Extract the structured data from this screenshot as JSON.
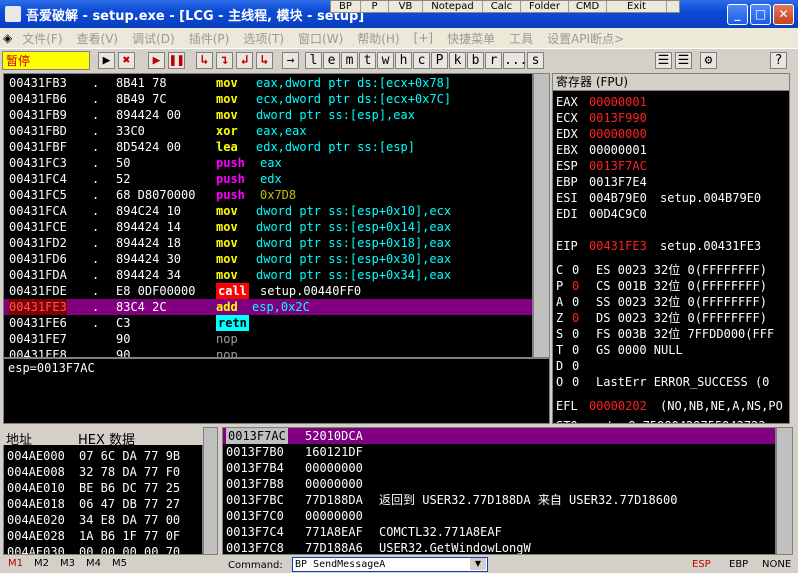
{
  "window": {
    "title": "吾爱破解 - setup.exe - [LCG - 主线程, 模块 - setup]",
    "minimize": "_",
    "maximize": "□",
    "close": "✕"
  },
  "plugin_bar": [
    "BP",
    "P",
    "VB",
    "Notepad",
    "Calc",
    "Folder",
    "CMD",
    "Exit"
  ],
  "menu": [
    "文件(F)",
    "查看(V)",
    "调试(D)",
    "插件(P)",
    "选项(T)",
    "窗口(W)",
    "帮助(H)",
    "[+]",
    "快捷菜单",
    "工具",
    "设置API断点>"
  ],
  "toolbar": {
    "status": "暂停",
    "buttons": [
      "▶",
      "✖",
      "▶",
      "❚❚",
      "↳",
      "↴",
      "↲",
      "↳",
      "→",
      "l",
      "e",
      "m",
      "t",
      "w",
      "h",
      "c",
      "P",
      "k",
      "b",
      "r",
      "...",
      "s",
      "☰",
      "☰",
      "⚙",
      "?"
    ]
  },
  "disasm": {
    "rows": [
      {
        "addr": "00431FB3",
        "dot": ".",
        "hex": "8B41 78",
        "op": "mov",
        "args": "eax,dword ptr ds:[ecx+0x78]",
        "kind": "mov"
      },
      {
        "addr": "00431FB6",
        "dot": ".",
        "hex": "8B49 7C",
        "op": "mov",
        "args": "ecx,dword ptr ds:[ecx+0x7C]",
        "kind": "mov"
      },
      {
        "addr": "00431FB9",
        "dot": ".",
        "hex": "894424 00",
        "op": "mov",
        "args": "dword ptr ss:[esp],eax",
        "kind": "mov"
      },
      {
        "addr": "00431FBD",
        "dot": ".",
        "hex": "33C0",
        "op": "xor",
        "args": "eax,eax",
        "kind": "mov"
      },
      {
        "addr": "00431FBF",
        "dot": ".",
        "hex": "8D5424 00",
        "op": "lea",
        "args": "edx,dword ptr ss:[esp]",
        "kind": "mov"
      },
      {
        "addr": "00431FC3",
        "dot": ".",
        "hex": "50",
        "op": "push",
        "args": "eax",
        "kind": "push"
      },
      {
        "addr": "00431FC4",
        "dot": ".",
        "hex": "52",
        "op": "push",
        "args": "edx",
        "kind": "push"
      },
      {
        "addr": "00431FC5",
        "dot": ".",
        "hex": "68 D8070000",
        "op": "push",
        "args": "0x7D8",
        "kind": "pushimm"
      },
      {
        "addr": "00431FCA",
        "dot": ".",
        "hex": "894C24 10",
        "op": "mov",
        "args": "dword ptr ss:[esp+0x10],ecx",
        "kind": "mov"
      },
      {
        "addr": "00431FCE",
        "dot": ".",
        "hex": "894424 14",
        "op": "mov",
        "args": "dword ptr ss:[esp+0x14],eax",
        "kind": "mov"
      },
      {
        "addr": "00431FD2",
        "dot": ".",
        "hex": "894424 18",
        "op": "mov",
        "args": "dword ptr ss:[esp+0x18],eax",
        "kind": "mov"
      },
      {
        "addr": "00431FD6",
        "dot": ".",
        "hex": "894424 30",
        "op": "mov",
        "args": "dword ptr ss:[esp+0x30],eax",
        "kind": "mov"
      },
      {
        "addr": "00431FDA",
        "dot": ".",
        "hex": "894424 34",
        "op": "mov",
        "args": "dword ptr ss:[esp+0x34],eax",
        "kind": "mov"
      },
      {
        "addr": "00431FDE",
        "dot": ".",
        "hex": "E8 0DF00000",
        "op": "call",
        "args": "setup.00440FF0",
        "kind": "call"
      },
      {
        "addr": "00431FE3",
        "dot": ".",
        "hex": "83C4 2C",
        "op": "add",
        "args": "esp,0x2C",
        "kind": "cur"
      },
      {
        "addr": "00431FE6",
        "dot": ".",
        "hex": "C3",
        "op": "retn",
        "args": "",
        "kind": "retn"
      },
      {
        "addr": "00431FE7",
        "dot": "",
        "hex": "90",
        "op": "nop",
        "args": "",
        "kind": "nop"
      },
      {
        "addr": "00431FE8",
        "dot": "",
        "hex": "90",
        "op": "nop",
        "args": "",
        "kind": "nop"
      }
    ]
  },
  "info_text": "esp=0013F7AC",
  "registers": {
    "header": "寄存器 (FPU)",
    "gp": [
      {
        "name": "EAX",
        "value": "00000001",
        "red": true,
        "comment": ""
      },
      {
        "name": "ECX",
        "value": "0013F990",
        "red": true,
        "comment": ""
      },
      {
        "name": "EDX",
        "value": "00000000",
        "red": true,
        "comment": ""
      },
      {
        "name": "EBX",
        "value": "00000001",
        "red": false,
        "comment": ""
      },
      {
        "name": "ESP",
        "value": "0013F7AC",
        "red": true,
        "comment": ""
      },
      {
        "name": "EBP",
        "value": "0013F7E4",
        "red": false,
        "comment": ""
      },
      {
        "name": "ESI",
        "value": "004B79E0",
        "red": false,
        "comment": "setup.004B79E0"
      },
      {
        "name": "EDI",
        "value": "00D4C9C0",
        "red": false,
        "comment": ""
      }
    ],
    "eip": {
      "name": "EIP",
      "value": "00431FE3",
      "comment": "setup.00431FE3"
    },
    "flags": [
      {
        "flag": "C",
        "val": "0",
        "red": false,
        "seg": "ES 0023 32位 0(FFFFFFFF)"
      },
      {
        "flag": "P",
        "val": "0",
        "red": true,
        "seg": "CS 001B 32位 0(FFFFFFFF)"
      },
      {
        "flag": "A",
        "val": "0",
        "red": false,
        "seg": "SS 0023 32位 0(FFFFFFFF)"
      },
      {
        "flag": "Z",
        "val": "0",
        "red": true,
        "seg": "DS 0023 32位 0(FFFFFFFF)"
      },
      {
        "flag": "S",
        "val": "0",
        "red": false,
        "seg": "FS 003B 32位 7FFDD000(FFF"
      },
      {
        "flag": "T",
        "val": "0",
        "red": false,
        "seg": "GS 0000 NULL"
      },
      {
        "flag": "D",
        "val": "0",
        "red": false,
        "seg": ""
      },
      {
        "flag": "O",
        "val": "0",
        "red": false,
        "seg": "LastErr ERROR_SUCCESS (0"
      }
    ],
    "efl": {
      "name": "EFL",
      "value": "00000202",
      "comment": "(NO,NB,NE,A,NS,PO"
    },
    "st0": "ST0 empty 8.75980429755943723"
  },
  "dump": {
    "col_addr": "地址",
    "col_hex": "HEX 数据",
    "rows": [
      {
        "addr": "004AE000",
        "hex": "07 6C DA 77 9B"
      },
      {
        "addr": "004AE008",
        "hex": "32 78 DA 77 F0"
      },
      {
        "addr": "004AE010",
        "hex": "BE B6 DC 77 25"
      },
      {
        "addr": "004AE018",
        "hex": "06 47 DB 77 27"
      },
      {
        "addr": "004AE020",
        "hex": "34 E8 DA 77 00"
      },
      {
        "addr": "004AE028",
        "hex": "1A B6 1F 77 0F"
      },
      {
        "addr": "004AE030",
        "hex": "00 00 00 00 70"
      }
    ]
  },
  "stack": {
    "rows": [
      {
        "addr": "0013F7AC",
        "val": "52010DCA",
        "comment": "",
        "cur": true
      },
      {
        "addr": "0013F7B0",
        "val": "160121DF",
        "comment": "",
        "cur": false
      },
      {
        "addr": "0013F7B4",
        "val": "00000000",
        "comment": "",
        "cur": false
      },
      {
        "addr": "0013F7B8",
        "val": "00000000",
        "comment": "",
        "cur": false
      },
      {
        "addr": "0013F7BC",
        "val": "77D188DA",
        "comment": "返回到 USER32.77D188DA 来自 USER32.77D18600",
        "cur": false
      },
      {
        "addr": "0013F7C0",
        "val": "00000000",
        "comment": "",
        "cur": false
      },
      {
        "addr": "0013F7C4",
        "val": "771A8EAF",
        "comment": "COMCTL32.771A8EAF",
        "cur": false
      },
      {
        "addr": "0013F7C8",
        "val": "77D188A6",
        "comment": "USER32.GetWindowLongW",
        "cur": false
      }
    ]
  },
  "bottom": {
    "tabs": [
      "M1",
      "M2",
      "M3",
      "M4",
      "M5"
    ],
    "command_label": "Command:",
    "command_value": "BP SendMessageA",
    "status_regs": [
      "ESP",
      "EBP",
      "NONE"
    ]
  },
  "colors": {
    "accent": "#0a3fc0",
    "current_line": "#800080",
    "changed_value": "#ff2020",
    "instruction": "#ffff00"
  }
}
